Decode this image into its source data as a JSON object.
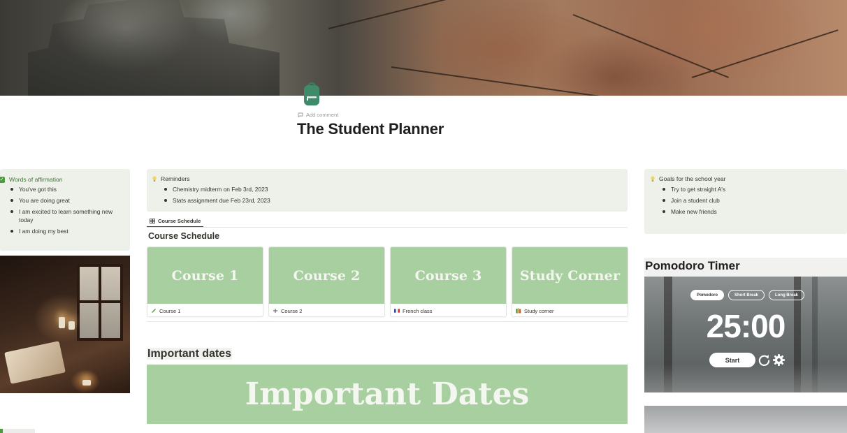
{
  "page": {
    "title": "The Student Planner",
    "add_comment": "Add comment",
    "icon": "backpack-icon"
  },
  "affirmations": {
    "heading": "Words of affirmation",
    "items": [
      "You've got this",
      "You are doing great",
      "I am excited to learn something new today",
      "I am doing my best"
    ]
  },
  "reminders": {
    "heading": "Reminders",
    "items": [
      "Chemistry midterm on Feb 3rd, 2023",
      "Stats assignment due Feb 23rd, 2023"
    ]
  },
  "goals": {
    "heading": "Goals for the school year",
    "items": [
      "Try to get straight A's",
      "Join a student club",
      "Make new friends"
    ]
  },
  "course_schedule": {
    "tab_label": "Course Schedule",
    "heading": "Course Schedule",
    "cards": [
      {
        "cover_text": "Course 1",
        "caption": "Course 1",
        "icon": "pencil-icon"
      },
      {
        "cover_text": "Course 2",
        "caption": "Course 2",
        "icon": "plus-icon"
      },
      {
        "cover_text": "Course 3",
        "caption": "French class",
        "icon": "french-flag-icon"
      },
      {
        "cover_text": "Study Corner",
        "caption": "Study corner",
        "icon": "books-icon"
      }
    ]
  },
  "important_dates": {
    "heading": "Important dates",
    "banner_text": "Important Dates"
  },
  "pomodoro": {
    "heading": "Pomodoro Timer",
    "modes": [
      "Pomodoro",
      "Short Break",
      "Long Break"
    ],
    "active_mode": "Pomodoro",
    "time": "25:00",
    "start_label": "Start"
  },
  "colors": {
    "callout_bg": "#eef0ea",
    "card_green": "#a8cfa0",
    "check_green": "#4c9a3e"
  }
}
